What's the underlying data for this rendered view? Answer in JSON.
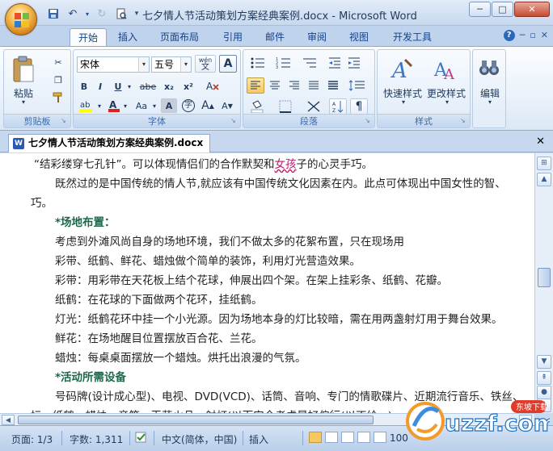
{
  "window": {
    "title": "七夕情人节活动策划方案经典案例.docx - Microsoft Word",
    "minimize": "─",
    "maximize": "□",
    "close": "✕"
  },
  "qat": {
    "save_icon": "save-icon",
    "undo_icon": "undo-icon",
    "redo_icon": "redo-icon",
    "print_preview_icon": "print-preview-icon"
  },
  "tabs": [
    {
      "label": "开始",
      "active": true
    },
    {
      "label": "插入"
    },
    {
      "label": "页面布局"
    },
    {
      "label": "引用"
    },
    {
      "label": "邮件"
    },
    {
      "label": "审阅"
    },
    {
      "label": "视图"
    },
    {
      "label": "开发工具"
    }
  ],
  "ribbon": {
    "clipboard": {
      "label": "剪贴板",
      "paste": "粘贴"
    },
    "font": {
      "label": "字体",
      "font_name": "宋体",
      "font_size": "五号",
      "bold": "B",
      "italic": "I",
      "underline": "U",
      "strike": "abe",
      "sub": "x₂",
      "sup": "x²",
      "grow": "A",
      "shrink": "A",
      "aa": "Aa",
      "char_border": "A",
      "enclose": "字",
      "wen": "wén",
      "phonetic": "文"
    },
    "paragraph": {
      "label": "段落"
    },
    "styles": {
      "label": "样式",
      "quick_styles": "快速样式",
      "change_styles": "更改样式"
    },
    "editing": {
      "label": "编辑"
    }
  },
  "doc_tab": {
    "title": "七夕情人节活动策划方案经典案例.docx",
    "close": "✕"
  },
  "document": {
    "line1_prefix": "“结彩缕穿七孔针”。可以体现情侣们的合作默契和",
    "line1_pink": "女孩",
    "line1_suffix": "子的心灵手巧。",
    "line2": "既然过的是中国传统的情人节,就应该有中国传统文化因素在内。此点可体现出中国女性的智、",
    "line3": "巧。",
    "heading1": "*场地布置：",
    "line4": "考虑到外滩风尚自身的场地环境，我们不做太多的花絮布置，只在现场用",
    "line5": "彩带、纸鹤、鲜花、蜡烛做个简单的装饰，利用灯光营造效果。",
    "line6": "彩带：用彩带在天花板上结个花球，伸展出四个架。在架上挂彩条、纸鹤、花瓣。",
    "line7": "纸鹤：在花球的下面做两个花环，挂纸鹤。",
    "line8": "灯光：纸鹤花环中挂一个小光源。因为场地本身的灯比较暗，需在用两盏射灯用于舞台效果。",
    "line9": "鲜花：在场地醒目位置摆放百合花、兰花。",
    "line10": "蜡烛：每桌桌面摆放一个蜡烛。烘托出浪漫的气氛。",
    "heading2": "*活动所需设备",
    "line11": "号码牌(设计成心型)、电视、DVD(VCD)、话筒、音响、专门的情歌碟片、近期流行音乐、铁丝、",
    "line12": "坛、纸鹤、蜡烛、音箱、玉茫火品、射灯(以面安全考虑暴好偏行(以不给...)"
  },
  "status": {
    "page": "页面: 1/3",
    "words": "字数: 1,311",
    "language": "中文(简体，中国)",
    "insert": "插入",
    "zoom": "100"
  },
  "watermark": {
    "brand": "uzzf.com",
    "sub": "东坡下载"
  }
}
